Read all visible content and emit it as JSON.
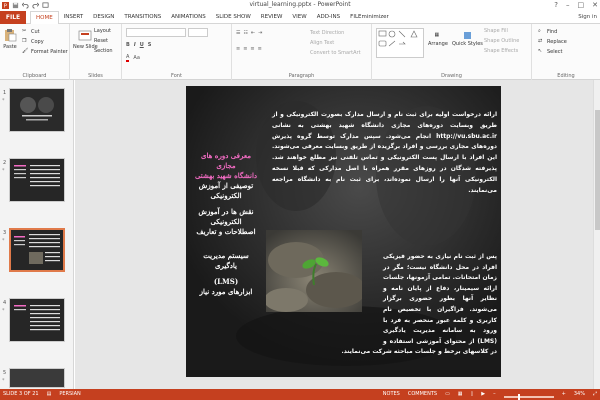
{
  "window": {
    "title": "virtual_learning.pptx - PowerPoint",
    "controls": [
      "?",
      "–",
      "□",
      "✕"
    ]
  },
  "tabs": {
    "file": "FILE",
    "items": [
      "HOME",
      "INSERT",
      "DESIGN",
      "TRANSITIONS",
      "ANIMATIONS",
      "SLIDE SHOW",
      "REVIEW",
      "VIEW",
      "ADD-INS",
      "FILEminimizer"
    ],
    "active": "HOME",
    "signin": "Sign in"
  },
  "ribbon": {
    "clipboard": {
      "name": "Clipboard",
      "paste": "Paste",
      "cut": "Cut",
      "copy": "Copy",
      "format_painter": "Format Painter"
    },
    "slides": {
      "name": "Slides",
      "new_slide": "New Slide",
      "layout": "Layout",
      "reset": "Reset",
      "section": "Section"
    },
    "font": {
      "name": "Font"
    },
    "paragraph": {
      "name": "Paragraph",
      "text_direction": "Text Direction",
      "align_text": "Align Text",
      "convert": "Convert to SmartArt"
    },
    "drawing": {
      "name": "Drawing",
      "arrange": "Arrange",
      "quick_styles": "Quick Styles",
      "shape_fill": "Shape Fill",
      "shape_outline": "Shape Outline",
      "shape_effects": "Shape Effects"
    },
    "editing": {
      "name": "Editing",
      "find": "Find",
      "replace": "Replace",
      "select": "Select"
    }
  },
  "slides_panel": {
    "thumbnails": [
      {
        "num": "1",
        "star": "*"
      },
      {
        "num": "2",
        "star": "*"
      },
      {
        "num": "3",
        "star": "*"
      },
      {
        "num": "4",
        "star": "*"
      },
      {
        "num": "5",
        "star": "*"
      }
    ]
  },
  "slide": {
    "side_menu": [
      "معرفی دوره های",
      "مجازی",
      "دانشگاه شهید بهشتی",
      "توصیفی از آموزش",
      "الکترونیکی",
      "نقش ها در آموزش",
      "الکترونیکی",
      "اصطلاحات و تعاریف",
      "سیستم مدیریت",
      "یادگیری",
      "(LMS)",
      "ابزارهای مورد نیاز"
    ],
    "paragraph1": "ارائه درخواست اولیه برای ثبت نام و ارسال مدارک بصورت الکترونیکی و از طریق وبسایت دوره‌های مجازی دانشگاه شهید بهشتی به نشانی http://vu.sbu.ac.ir انجام می‌شود. سپس مدارک توسط گروه پذیرش دوره‌های مجازی بررسی و افراد برگزیده از طریق وبسایت معرفی می‌شوند. این افراد با ارسال پست الکترونیکی و تماس تلفنی نیز مطلع خواهند شد. پذیرفته شدگان در روزهای مقرر همراه با اصل مدارکی که قبلا نسخه الکترونیکی آنها را ارسال نموده‌اند، برای ثبت نام به دانشگاه مراجعه می‌نمایند.",
    "paragraph2": "پس از ثبت نام نیازی به حضور فیزیکی افراد در محل دانشگاه نیست؛ مگر در زمان امتحانات. تمامی آزمونها، جلسات ارائه سیمینار، دفاع از پایان نامه و نظایر آنها بطور حضوری برگزار می‌شوند. فراگیران با تخصیص نام کاربری و کلمه عبور منحصر به فرد با ورود به سامانه مدیریت یادگیری (LMS) از محتوای آموزشی استفاده و در کلاسهای برخط و جلسات مباحثه شرکت می‌نمایند."
  },
  "status": {
    "slide": "SLIDE 3 OF 21",
    "language": "PERSIAN",
    "notes": "NOTES",
    "comments": "COMMENTS",
    "zoom": "34%"
  },
  "colors": {
    "accent": "#c5401f",
    "slide_bg": "#1f1f1f",
    "menu_pink": "#f36cc4"
  }
}
